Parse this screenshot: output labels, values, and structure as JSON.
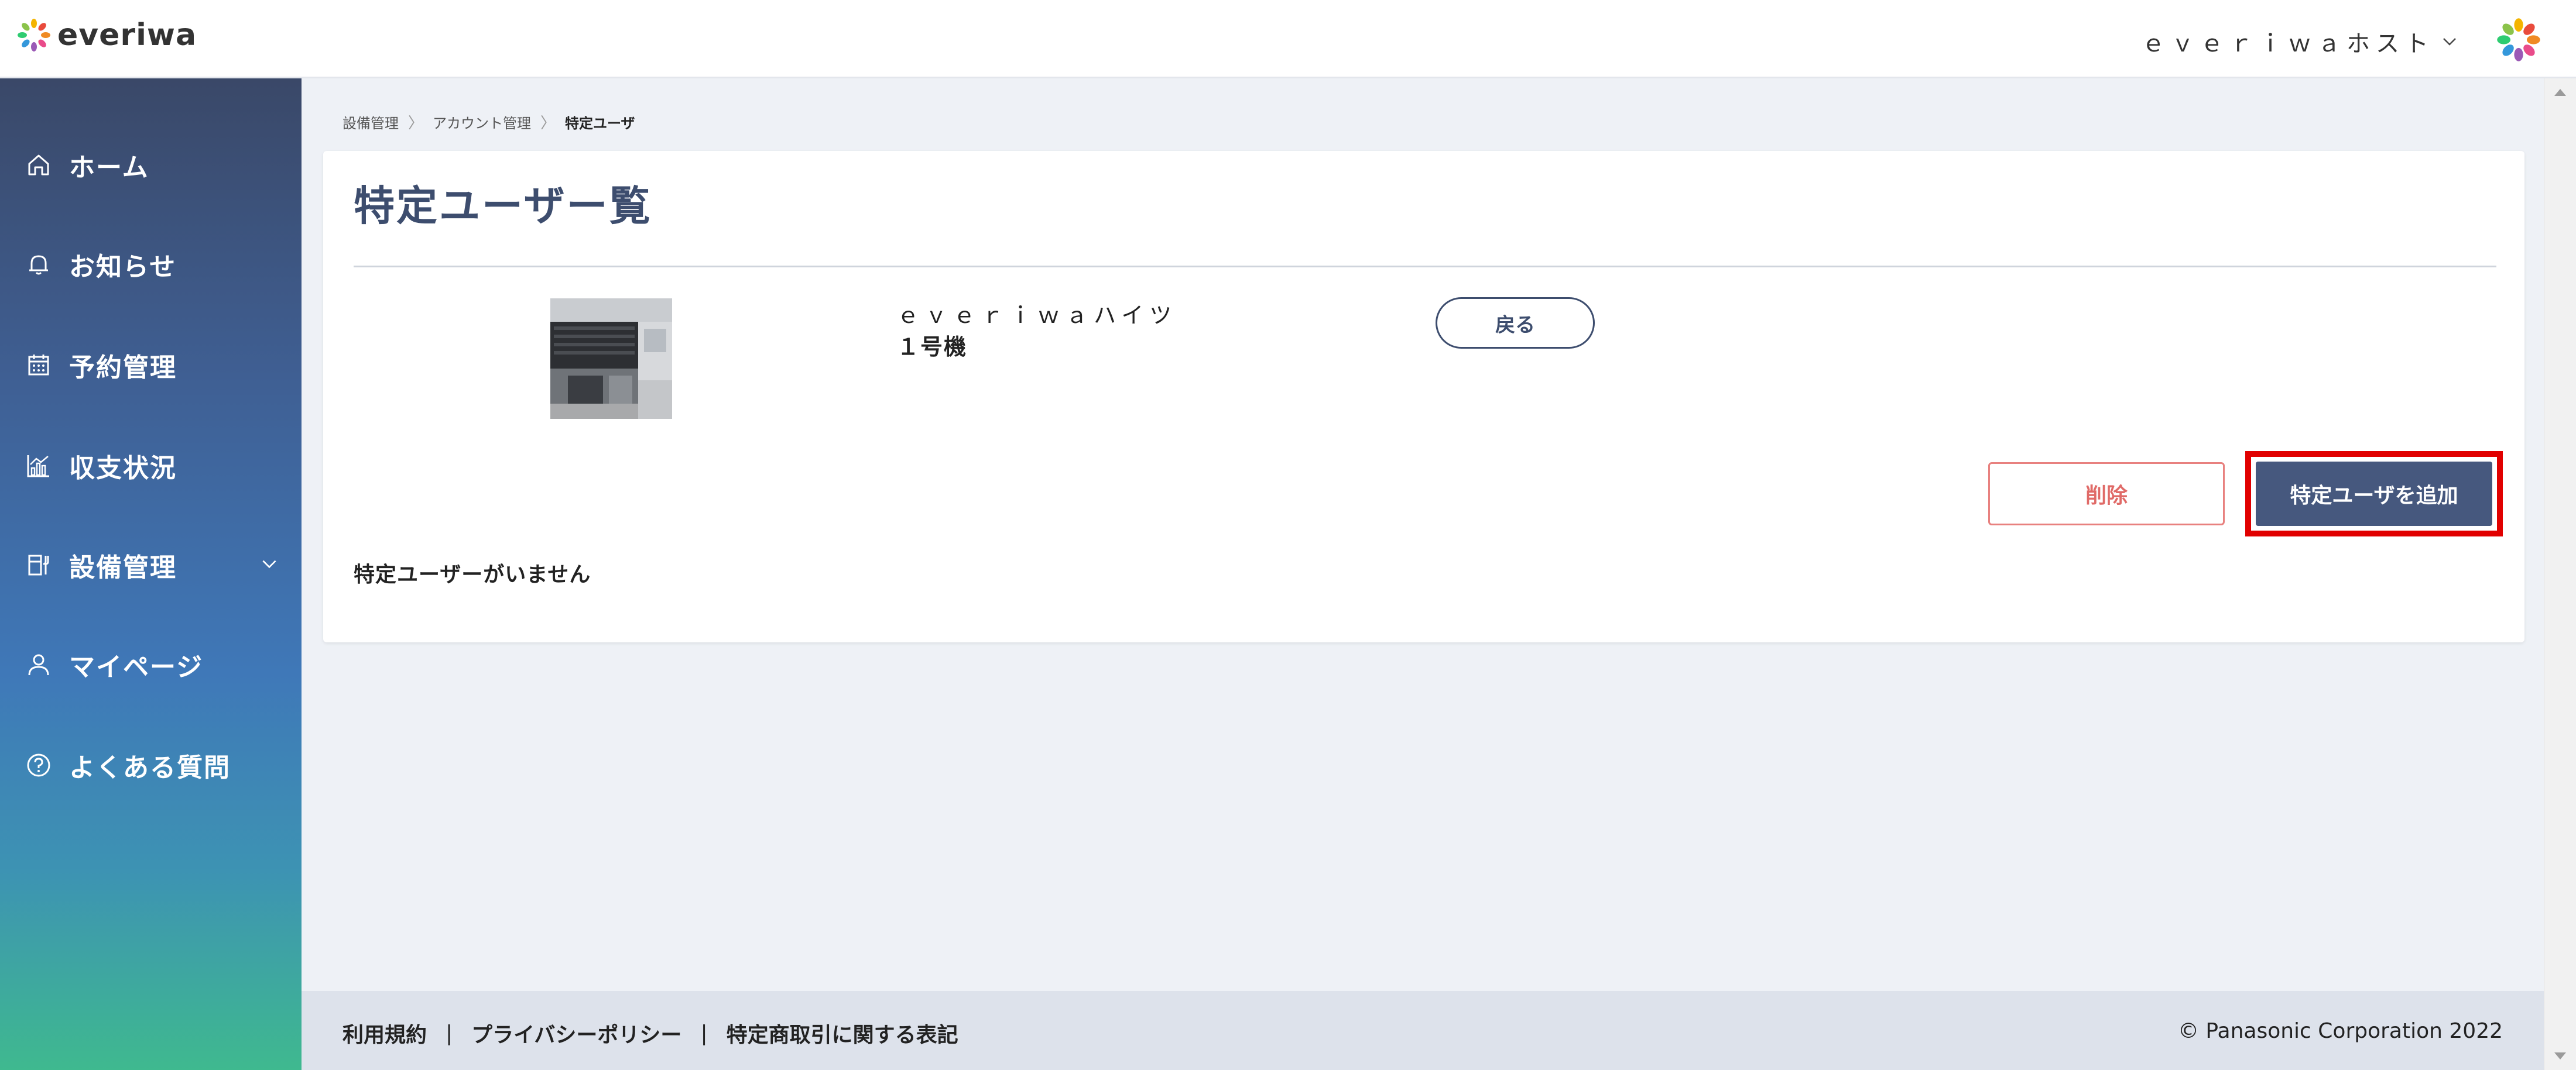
{
  "header": {
    "logo_text": "everiwa",
    "account_name": "ｅｖｅｒｉｗａホスト"
  },
  "sidebar": {
    "items": [
      {
        "label": "ホーム",
        "icon": "home-icon"
      },
      {
        "label": "お知らせ",
        "icon": "bell-icon"
      },
      {
        "label": "予約管理",
        "icon": "calendar-icon"
      },
      {
        "label": "収支状況",
        "icon": "chart-icon"
      },
      {
        "label": "設備管理",
        "icon": "equipment-icon"
      },
      {
        "label": "マイページ",
        "icon": "user-icon"
      },
      {
        "label": "よくある質問",
        "icon": "help-icon"
      }
    ]
  },
  "breadcrumb": {
    "items": [
      "設備管理",
      "アカウント管理",
      "特定ユーザ"
    ]
  },
  "main": {
    "title": "特定ユーザー覧",
    "property_name": "ｅｖｅｒｉｗａハイツ",
    "property_sub": "１号機",
    "back_label": "戻る",
    "delete_label": "削除",
    "add_label": "特定ユーザを追加",
    "empty_message": "特定ユーザーがいません"
  },
  "footer": {
    "links": [
      "利用規約",
      "プライバシーポリシー",
      "特定商取引に関する表記"
    ],
    "separator": "|",
    "copyright": "© Panasonic Corporation 2022"
  },
  "colors": {
    "accent": "#46587e",
    "title": "#3d4d6e",
    "delete": "#e06a67",
    "highlight": "#e10000"
  }
}
